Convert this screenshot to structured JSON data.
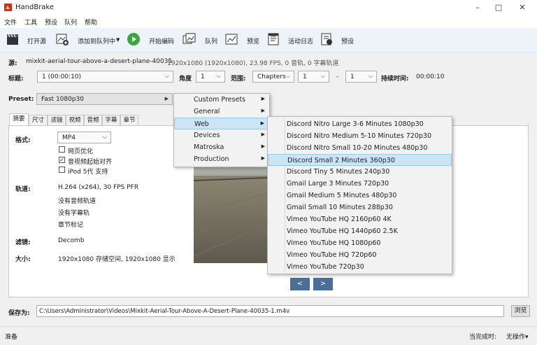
{
  "window": {
    "title": "HandBrake"
  },
  "menu": [
    "文件",
    "工具",
    "预设",
    "队列",
    "帮助"
  ],
  "toolbar": {
    "open_source": "打开源",
    "add_to_queue": "添加到队列中",
    "start_encode": "开始编码",
    "queue": "队列",
    "preview": "预览",
    "activity_log": "活动日志",
    "presets": "预设"
  },
  "source": {
    "label": "源:",
    "name": "mixkit-aerial-tour-above-a-desert-plane-40035",
    "info": "1920x1080 (1920x1080), 23.98 FPS, 0 音轨, 0 字幕轨道"
  },
  "title_row": {
    "title_label": "标题:",
    "title_value": "1  (00:00:10)",
    "angle_label": "角度",
    "angle_value": "1",
    "range_label": "范围:",
    "range_type": "Chapters",
    "range_start": "1",
    "range_dash": "-",
    "range_end": "1",
    "duration_label": "持续时间:",
    "duration_value": "00:00:10"
  },
  "preset": {
    "label": "Preset:",
    "value": "Fast 1080p30"
  },
  "tabs": [
    "摘要",
    "尺寸",
    "滤镜",
    "视频",
    "音频",
    "字幕",
    "章节"
  ],
  "summary": {
    "format_label": "格式:",
    "format_value": "MP4",
    "web_optimize": "网页优化",
    "align_av": "音视频起始对齐",
    "ipod": "iPod 5代 支持",
    "tracks_label": "轨道:",
    "tracks": [
      "H.264 (x264), 30 FPS PFR",
      "没有音频轨道",
      "没有字幕轨",
      "章节标记"
    ],
    "filters_label": "滤镜:",
    "filters_value": "Decomb",
    "size_label": "大小:",
    "size_value": "1920x1080 存储空间, 1920x1080 显示"
  },
  "preset_menu": [
    {
      "label": "Custom Presets",
      "highlighted": false
    },
    {
      "label": "General",
      "highlighted": false
    },
    {
      "label": "Web",
      "highlighted": true
    },
    {
      "label": "Devices",
      "highlighted": false
    },
    {
      "label": "Matroska",
      "highlighted": false
    },
    {
      "label": "Production",
      "highlighted": false
    }
  ],
  "web_submenu": [
    "Discord Nitro Large 3-6 Minutes 1080p30",
    "Discord Nitro Medium 5-10 Minutes 720p30",
    "Discord Nitro Small 10-20 Minutes 480p30",
    "Discord Small 2 Minutes 360p30",
    "Discord Tiny 5 Minutes 240p30",
    "Gmail Large 3 Minutes 720p30",
    "Gmail Medium 5 Minutes 480p30",
    "Gmail Small 10 Minutes 288p30",
    "Vimeo YouTube HQ 2160p60 4K",
    "Vimeo YouTube HQ 1440p60 2.5K",
    "Vimeo YouTube HQ 1080p60",
    "Vimeo YouTube HQ 720p60",
    "Vimeo YouTube 720p30"
  ],
  "web_submenu_highlighted": "Discord Small 2 Minutes 360p30",
  "nav": {
    "prev": "<",
    "next": ">"
  },
  "save": {
    "label": "保存为:",
    "path": "C:\\Users\\Administrator\\Videos\\Mixkit-Aerial-Tour-Above-A-Desert-Plane-40035-1.m4v",
    "browse": "浏览"
  },
  "status": {
    "ready": "准备",
    "when_done_label": "当完成时:",
    "when_done_value": "无操作▾"
  }
}
